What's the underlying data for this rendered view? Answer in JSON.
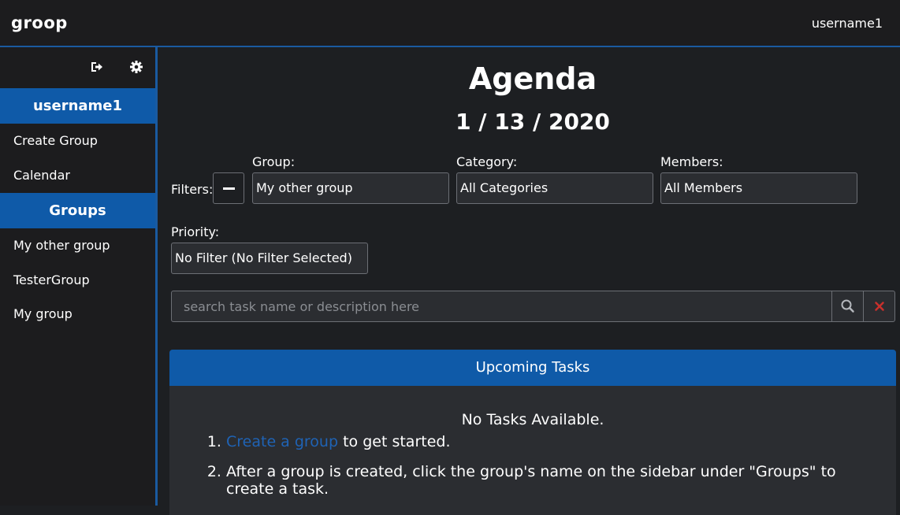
{
  "navbar": {
    "brand": "groop",
    "username": "username1"
  },
  "sidebar": {
    "tools": [
      {
        "icon": "sign-out-icon"
      },
      {
        "icon": "gear-icon"
      }
    ],
    "user_header": "username1",
    "user_links": [
      "Create Group",
      "Calendar"
    ],
    "groups_header": "Groups",
    "groups": [
      "My other group",
      "TesterGroup",
      "My group"
    ]
  },
  "main": {
    "title": "Agenda",
    "date": "1 / 13 / 2020",
    "filters": {
      "filters_label": "Filters:",
      "group_label": "Group:",
      "group_value": "My other group",
      "category_label": "Category:",
      "category_value": "All Categories",
      "members_label": "Members:",
      "members_value": "All Members",
      "priority_label": "Priority:",
      "priority_value": "No Filter (No Filter Selected)"
    },
    "search": {
      "placeholder": "search task name or description here",
      "search_icon": "search-icon",
      "clear_icon": "close-icon"
    },
    "tasks_panel": {
      "header": "Upcoming Tasks",
      "empty_message": "No Tasks Available.",
      "step1_link": "Create a group",
      "step1_rest": "to get started.",
      "step2": "After a group is created, click the group's name on the sidebar under \"Groups\" to create a task."
    }
  },
  "colors": {
    "accent": "#0f5aa8",
    "link": "#1f63b5",
    "background": "#1d1f22",
    "clear_icon": "#c9302c"
  }
}
